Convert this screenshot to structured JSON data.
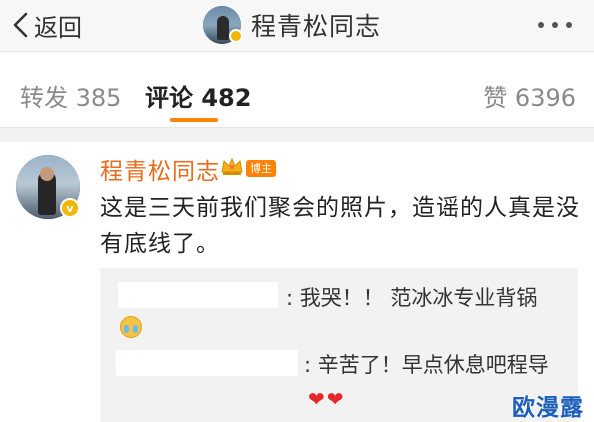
{
  "header": {
    "back_label": "返回",
    "title": "程青松同志"
  },
  "tabs": {
    "repost": {
      "label": "转发",
      "count": "385"
    },
    "comment": {
      "label": "评论",
      "count": "482"
    },
    "like": {
      "label": "赞",
      "count": "6396"
    },
    "active_color": "#ff8200"
  },
  "comment": {
    "author": "程青松同志",
    "owner_badge": "博主",
    "text": "这是三天前我们聚会的照片，造谣的人真是没有底线了。",
    "author_color": "#e86c1c"
  },
  "replies": [
    {
      "text": ": 我哭！！ 范冰冰专业背锅",
      "emoji": "crying-face"
    },
    {
      "text": ": 辛苦了！早点休息吧程导",
      "hearts": "❤❤"
    }
  ],
  "watermark": "欧漫露",
  "icons": [
    "back-chevron-icon",
    "more-dots-icon",
    "verified-badge-icon",
    "crown-icon",
    "crying-emoji-icon",
    "heart-icon"
  ]
}
